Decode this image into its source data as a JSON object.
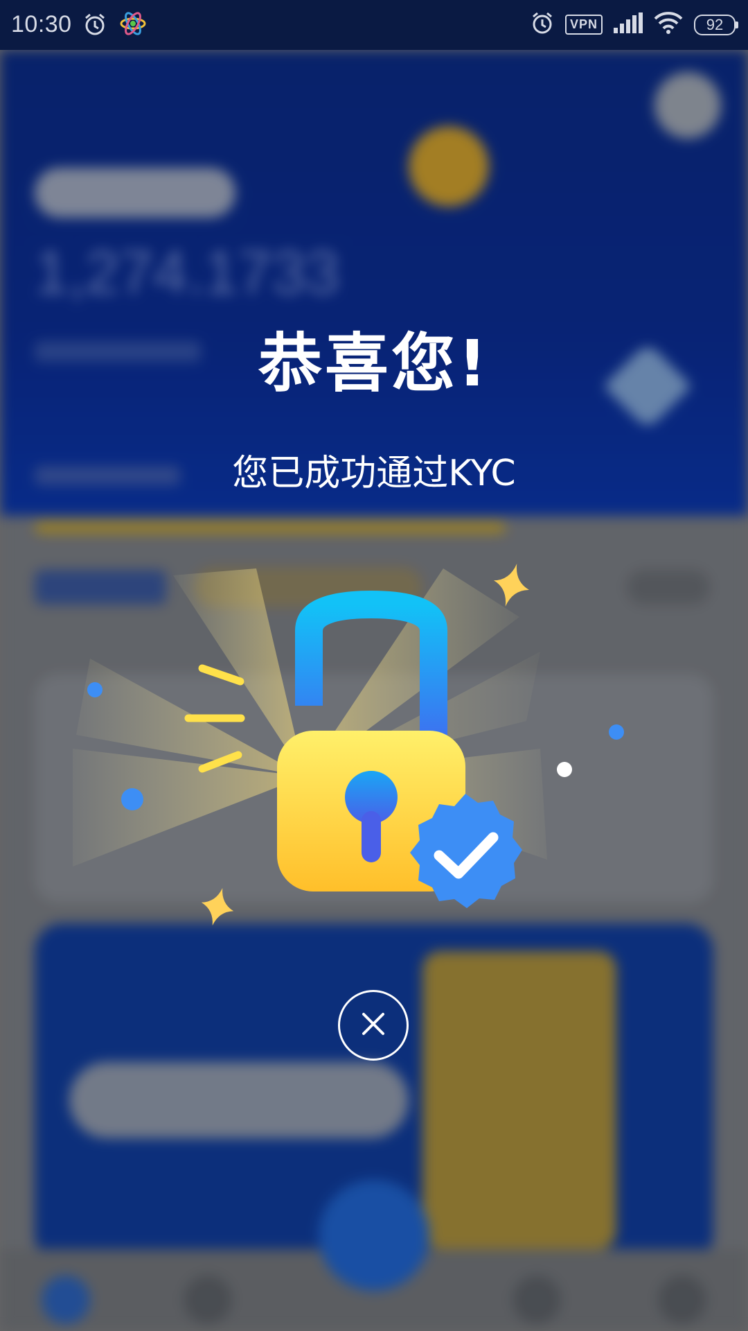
{
  "status_bar": {
    "time": "10:30",
    "vpn_label": "VPN",
    "battery": "92",
    "icons": [
      "alarm-icon",
      "atom-app-icon",
      "alarm-icon",
      "vpn-icon",
      "signal-icon",
      "wifi-icon",
      "battery-icon"
    ]
  },
  "background_app": {
    "balance": "1,274.1733"
  },
  "modal": {
    "title": "恭喜您!",
    "subtitle": "您已成功通过KYC",
    "illustration_icon": "unlocked-padlock-verified-icon",
    "close_icon": "close-icon"
  },
  "colors": {
    "lock_body": "#ffd84a",
    "lock_shackle": "#1aa6f5",
    "badge": "#3d8ef5",
    "sparkle": "#ffd25a",
    "header_bg": "#0a2a82"
  }
}
